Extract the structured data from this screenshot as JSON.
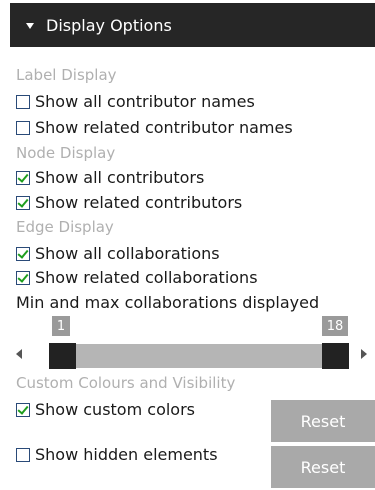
{
  "header": {
    "title": "Display Options"
  },
  "label_display": {
    "heading": "Label Display",
    "options": [
      {
        "label": "Show all contributor names",
        "checked": false
      },
      {
        "label": "Show related contributor names",
        "checked": false
      }
    ]
  },
  "node_display": {
    "heading": "Node Display",
    "options": [
      {
        "label": "Show all contributors",
        "checked": true
      },
      {
        "label": "Show related contributors",
        "checked": true
      }
    ]
  },
  "edge_display": {
    "heading": "Edge Display",
    "options": [
      {
        "label": "Show all collaborations",
        "checked": true
      },
      {
        "label": "Show related collaborations",
        "checked": true
      }
    ]
  },
  "slider": {
    "label": "Min and max collaborations displayed",
    "min_value": "1",
    "max_value": "18"
  },
  "custom": {
    "heading": "Custom Colours and Visibility",
    "show_custom_colors": {
      "label": "Show custom colors",
      "checked": true
    },
    "show_hidden_elements": {
      "label": "Show hidden elements",
      "checked": false
    },
    "reset_label_1": "Reset",
    "reset_label_2": "Reset"
  },
  "colors": {
    "header_bg": "#262626",
    "checkmark": "#1e9e1e",
    "section_label": "#b0b0b0",
    "track": "#b5b5b5",
    "handle": "#222222",
    "button": "#a9a9a9"
  }
}
